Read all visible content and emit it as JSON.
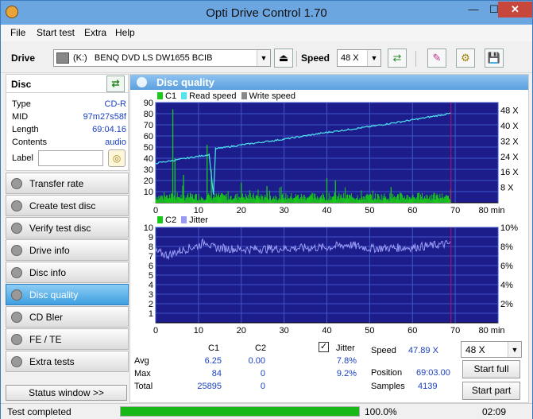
{
  "window": {
    "title": "Opti Drive Control 1.70",
    "minimize": "—",
    "maximize": "☐",
    "close": "✕"
  },
  "menu": [
    "File",
    "Start test",
    "Extra",
    "Help"
  ],
  "toolbar": {
    "drive_label": "Drive",
    "drive_letter": "(K:)",
    "drive_name": "BENQ   DVD LS DW1655 BCIB",
    "speed_label": "Speed",
    "speed_value": "48 X"
  },
  "disc": {
    "header": "Disc",
    "type_k": "Type",
    "type_v": "CD-R",
    "mid_k": "MID",
    "mid_v": "97m27s58f",
    "length_k": "Length",
    "length_v": "69:04.16",
    "contents_k": "Contents",
    "contents_v": "audio",
    "label_k": "Label"
  },
  "nav": [
    "Transfer rate",
    "Create test disc",
    "Verify test disc",
    "Drive info",
    "Disc info",
    "Disc quality",
    "CD Bler",
    "FE / TE",
    "Extra tests"
  ],
  "status_window": "Status window >>",
  "main": {
    "title": "Disc quality",
    "legend1": {
      "c1": "C1",
      "read": "Read speed",
      "write": "Write speed"
    },
    "legend2": {
      "c2": "C2",
      "jitter": "Jitter"
    }
  },
  "chart_data": [
    {
      "type": "bar",
      "series": [
        {
          "name": "C1",
          "note": "per-minute error counts, mostly 0-10 with spikes"
        },
        {
          "name": "Read speed"
        }
      ],
      "x_ticks": [
        "0",
        "10",
        "20",
        "30",
        "40",
        "50",
        "60",
        "70",
        "80 min"
      ],
      "y_ticks_left": [
        "90",
        "80",
        "70",
        "60",
        "50",
        "40",
        "30",
        "20",
        "10"
      ],
      "y_ticks_right": [
        "48 X",
        "40 X",
        "32 X",
        "24 X",
        "16 X",
        "8 X"
      ],
      "xlim": [
        0,
        80
      ],
      "ylim": [
        0,
        90
      ],
      "c1_spikes": [
        [
          4,
          84
        ],
        [
          12,
          52
        ],
        [
          4.5,
          40
        ],
        [
          6.5,
          25
        ],
        [
          13,
          30
        ],
        [
          20,
          18
        ],
        [
          40,
          22
        ],
        [
          42,
          20
        ],
        [
          26,
          15
        ],
        [
          55,
          14
        ]
      ],
      "read_speed": [
        [
          0,
          20.5
        ],
        [
          12.5,
          25
        ],
        [
          13.5,
          4
        ],
        [
          14,
          28
        ],
        [
          20,
          30
        ],
        [
          30,
          33
        ],
        [
          40,
          36.5
        ],
        [
          50,
          39.5
        ],
        [
          60,
          43
        ],
        [
          70,
          46.8
        ]
      ],
      "data_end": 69
    },
    {
      "type": "line",
      "series": [
        {
          "name": "C2",
          "values": "all 0"
        },
        {
          "name": "Jitter"
        }
      ],
      "x_ticks": [
        "0",
        "10",
        "20",
        "30",
        "40",
        "50",
        "60",
        "70",
        "80 min"
      ],
      "y_ticks_left": [
        "10",
        "9",
        "8",
        "7",
        "6",
        "5",
        "4",
        "3",
        "2",
        "1"
      ],
      "y_ticks_right": [
        "10%",
        "8%",
        "6%",
        "4%",
        "2%"
      ],
      "xlim": [
        0,
        80
      ],
      "ylim": [
        0,
        10
      ],
      "jitter_pct": [
        [
          0,
          7.4
        ],
        [
          3,
          7.1
        ],
        [
          6,
          7.6
        ],
        [
          10,
          8.1
        ],
        [
          12,
          8.6
        ],
        [
          13,
          7.9
        ],
        [
          20,
          7.7
        ],
        [
          30,
          7.8
        ],
        [
          40,
          7.9
        ],
        [
          45,
          8.2
        ],
        [
          50,
          7.8
        ],
        [
          60,
          7.9
        ],
        [
          69,
          8.3
        ]
      ]
    }
  ],
  "stats": {
    "col_c1": "C1",
    "col_c2": "C2",
    "jitter_label": "Jitter",
    "check": "✓",
    "avg_k": "Avg",
    "avg_c1": "6.25",
    "avg_c2": "0.00",
    "avg_j": "7.8%",
    "max_k": "Max",
    "max_c1": "84",
    "max_c2": "0",
    "max_j": "9.2%",
    "total_k": "Total",
    "total_c1": "25895",
    "total_c2": "0",
    "speed_k": "Speed",
    "speed_v": "47.89 X",
    "position_k": "Position",
    "position_v": "69:03.00",
    "samples_k": "Samples",
    "samples_v": "4139",
    "speed_select": "48 X",
    "start_full": "Start full",
    "start_part": "Start part"
  },
  "statusbar": {
    "text": "Test completed",
    "progress": "100.0%",
    "progress_fraction": 1.0,
    "time": "02:09"
  },
  "colors": {
    "plot_bg": "#1c1c8a",
    "grid": "#3f56c8",
    "c1": "#19c919",
    "read": "#4fe6f0",
    "jitter": "#9a9af5",
    "end_line": "#c01060",
    "accent": "#3e9fe0"
  }
}
